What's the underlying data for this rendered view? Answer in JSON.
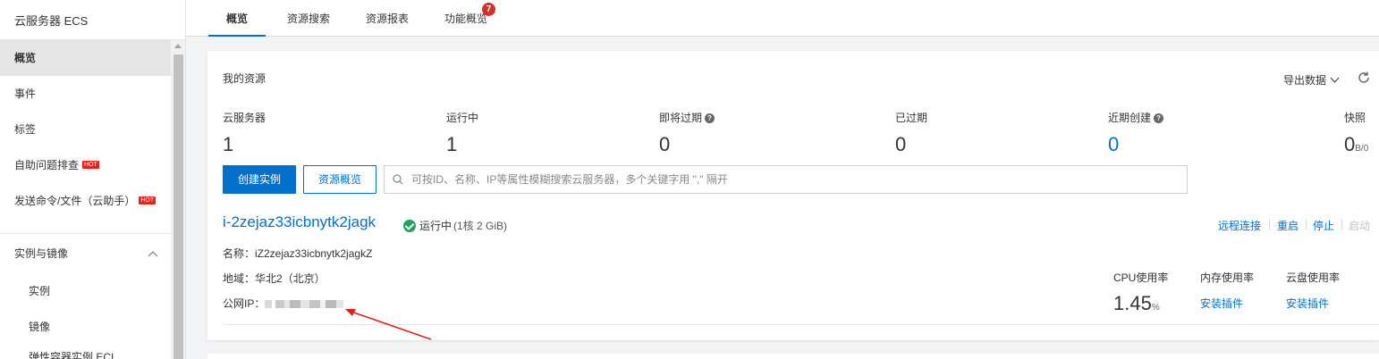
{
  "sidebar": {
    "title": "云服务器 ECS",
    "items": [
      {
        "label": "概览",
        "active": true
      },
      {
        "label": "事件"
      },
      {
        "label": "标签"
      },
      {
        "label": "自助问题排查",
        "hot": "HOT"
      },
      {
        "label": "发送命令/文件（云助手）",
        "hot": "HOT"
      }
    ],
    "group": {
      "label": "实例与镜像",
      "chevron": "chevron-up-icon"
    },
    "sub_items": [
      {
        "label": "实例"
      },
      {
        "label": "镜像"
      },
      {
        "label": "弹性容器实例 ECI"
      }
    ]
  },
  "tabs": [
    {
      "label": "概览",
      "active": true
    },
    {
      "label": "资源搜索"
    },
    {
      "label": "资源报表"
    },
    {
      "label": "功能概览",
      "badge": "7"
    }
  ],
  "resources": {
    "title": "我的资源",
    "export_label": "导出数据",
    "refresh_icon": "refresh-icon",
    "stats": [
      {
        "label": "云服务器",
        "value": "1"
      },
      {
        "label": "运行中",
        "value": "1"
      },
      {
        "label": "即将过期",
        "value": "0",
        "help": "?"
      },
      {
        "label": "已过期",
        "value": "0"
      },
      {
        "label": "近期创建",
        "value": "0",
        "help": "?",
        "highlight": true
      },
      {
        "label": "快照",
        "value": "0",
        "unit": "B/0"
      }
    ],
    "create_button": "创建实例",
    "overview_button": "资源概览",
    "search_placeholder": "可按ID、名称、IP等属性模糊搜索云服务器，多个关键字用 \",\" 隔开"
  },
  "instance": {
    "id": "i-2zejaz33icbnytk2jagk",
    "status": "运行中",
    "spec": "(1核 2 GiB)",
    "name_line": "名称：iZ2zejaz33icbnytk2jagkZ",
    "region_line": "地域：华北2（北京）",
    "ip_label": "公网IP：",
    "actions": [
      {
        "label": "远程连接"
      },
      {
        "label": "重启"
      },
      {
        "label": "停止"
      },
      {
        "label": "启动",
        "disabled": true
      }
    ],
    "metrics": {
      "cpu": {
        "label": "CPU使用率",
        "value": "1.45",
        "unit": "%"
      },
      "memory": {
        "label": "内存使用率",
        "link": "安装插件"
      },
      "disk": {
        "label": "云盘使用率",
        "link": "安装插件"
      }
    }
  },
  "colors": {
    "primary": "#0070cc",
    "hot": "#e1251b",
    "success": "#1fa55b",
    "annotation": "#e02020"
  }
}
